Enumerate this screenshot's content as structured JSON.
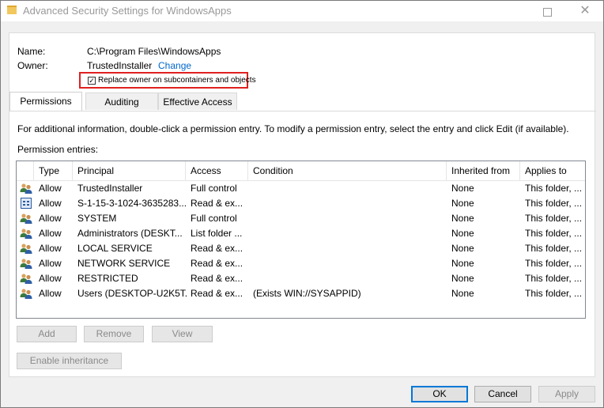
{
  "window": {
    "title": "Advanced Security Settings for WindowsApps",
    "maximize_icon": "maximize-icon",
    "close_glyph": "✕"
  },
  "info": {
    "name_label": "Name:",
    "name_value": "C:\\Program Files\\WindowsApps",
    "owner_label": "Owner:",
    "owner_value": "TrustedInstaller",
    "change_link": "Change",
    "replace_owner_label": "Replace owner on subcontainers and objects",
    "replace_owner_checked": true
  },
  "tabs": [
    {
      "label": "Permissions",
      "active": true
    },
    {
      "label": "Auditing",
      "active": false
    },
    {
      "label": "Effective Access",
      "active": false
    }
  ],
  "permissions": {
    "info_text": "For additional information, double-click a permission entry. To modify a permission entry, select the entry and click Edit (if available).",
    "entries_label": "Permission entries:",
    "columns": [
      "Type",
      "Principal",
      "Access",
      "Condition",
      "Inherited from",
      "Applies to"
    ],
    "rows": [
      {
        "icon": "users-icon",
        "type": "Allow",
        "principal": "TrustedInstaller",
        "access": "Full control",
        "condition": "",
        "inherited": "None",
        "applies": "This folder, ..."
      },
      {
        "icon": "sid-icon",
        "type": "Allow",
        "principal": "S-1-15-3-1024-3635283...",
        "access": "Read & ex...",
        "condition": "",
        "inherited": "None",
        "applies": "This folder, ..."
      },
      {
        "icon": "users-icon",
        "type": "Allow",
        "principal": "SYSTEM",
        "access": "Full control",
        "condition": "",
        "inherited": "None",
        "applies": "This folder, ..."
      },
      {
        "icon": "users-icon",
        "type": "Allow",
        "principal": "Administrators (DESKT...",
        "access": "List folder ...",
        "condition": "",
        "inherited": "None",
        "applies": "This folder, ..."
      },
      {
        "icon": "users-icon",
        "type": "Allow",
        "principal": "LOCAL SERVICE",
        "access": "Read & ex...",
        "condition": "",
        "inherited": "None",
        "applies": "This folder, ..."
      },
      {
        "icon": "users-icon",
        "type": "Allow",
        "principal": "NETWORK SERVICE",
        "access": "Read & ex...",
        "condition": "",
        "inherited": "None",
        "applies": "This folder, ..."
      },
      {
        "icon": "users-icon",
        "type": "Allow",
        "principal": "RESTRICTED",
        "access": "Read & ex...",
        "condition": "",
        "inherited": "None",
        "applies": "This folder, ..."
      },
      {
        "icon": "users-icon",
        "type": "Allow",
        "principal": "Users (DESKTOP-U2K5T...",
        "access": "Read & ex...",
        "condition": "(Exists WIN://SYSAPPID)",
        "inherited": "None",
        "applies": "This folder, ..."
      }
    ],
    "add_label": "Add",
    "remove_label": "Remove",
    "view_label": "View",
    "enable_inheritance_label": "Enable inheritance"
  },
  "footer": {
    "ok_label": "OK",
    "cancel_label": "Cancel",
    "apply_label": "Apply"
  },
  "colors": {
    "highlight_box": "#e02020",
    "link": "#0066cc",
    "focus": "#0078d7"
  }
}
